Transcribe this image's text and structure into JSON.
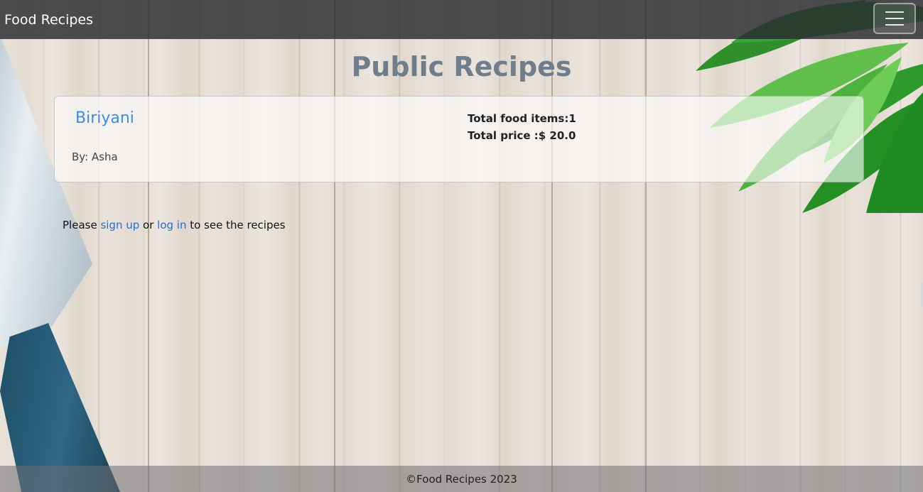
{
  "navbar": {
    "brand": "Food Recipes",
    "menu_icon": "hamburger-icon"
  },
  "page": {
    "title": "Public Recipes"
  },
  "recipes": [
    {
      "title": "Biriyani",
      "author": "By: Asha",
      "total_items": "Total food items:1",
      "total_price": "Total price :$ 20.0"
    }
  ],
  "notice": {
    "prefix": "Please ",
    "signup_label": "sign up",
    "middle": " or ",
    "login_label": "log in",
    "suffix": " to see the recipes"
  },
  "footer": {
    "text": "©Food Recipes 2023"
  },
  "colors": {
    "link": "#1f6fd6",
    "recipe_title": "#3d8ce6",
    "heading": "#707d8a",
    "navbar": "#2a2c2e"
  }
}
